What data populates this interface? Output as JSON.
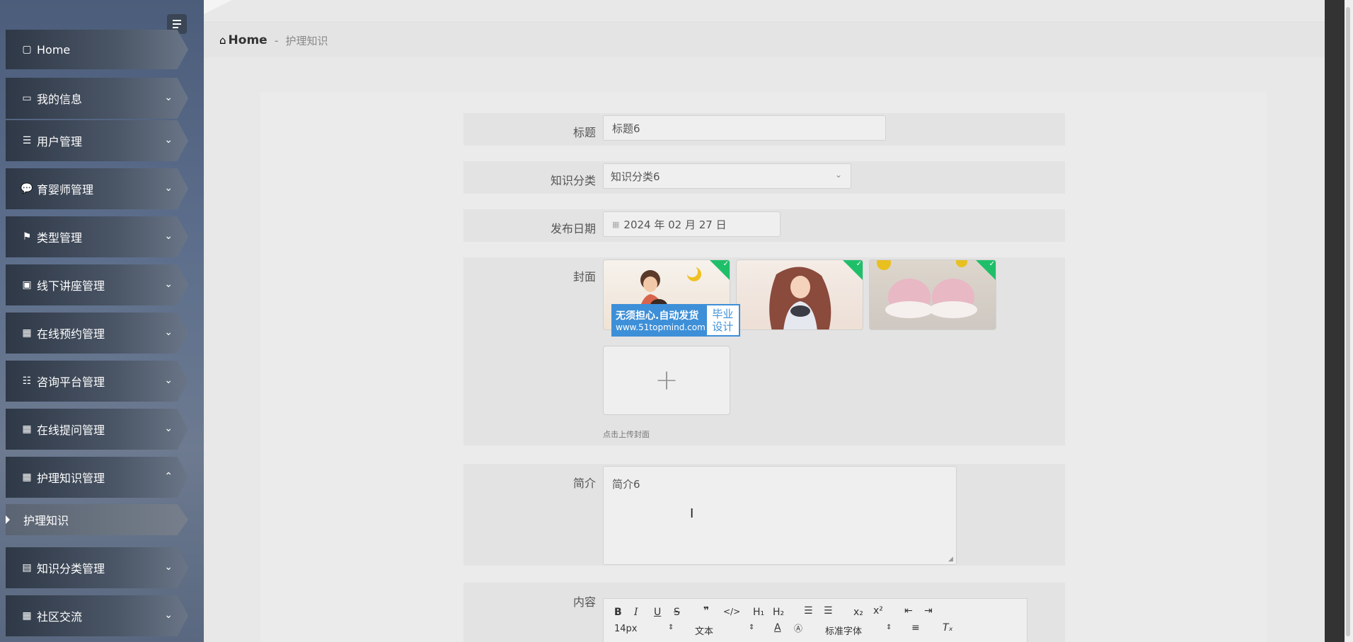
{
  "sidebar": {
    "items": [
      {
        "label": "Home",
        "icon": "home-icon"
      },
      {
        "label": "我的信息",
        "icon": "card-icon"
      },
      {
        "label": "用户管理",
        "icon": "list-icon"
      },
      {
        "label": "育婴师管理",
        "icon": "chat-icon"
      },
      {
        "label": "类型管理",
        "icon": "flag-icon"
      },
      {
        "label": "线下讲座管理",
        "icon": "briefcase-icon"
      },
      {
        "label": "在线预约管理",
        "icon": "grid-icon"
      },
      {
        "label": "咨询平台管理",
        "icon": "sliders-icon"
      },
      {
        "label": "在线提问管理",
        "icon": "grid-icon"
      },
      {
        "label": "护理知识管理",
        "icon": "grid-icon"
      },
      {
        "label": "知识分类管理",
        "icon": "wallet-icon"
      },
      {
        "label": "社区交流",
        "icon": "grid-icon"
      }
    ],
    "sub_item": "护理知识"
  },
  "breadcrumb": {
    "home": "Home",
    "separator": "-",
    "current": "护理知识"
  },
  "form": {
    "title_label": "标题",
    "title_value": "标题6",
    "category_label": "知识分类",
    "category_value": "知识分类6",
    "date_label": "发布日期",
    "date_value": "2024 年 02 月 27 日",
    "cover_label": "封面",
    "cover_hint": "点击上传封面",
    "intro_label": "简介",
    "intro_value": "简介6",
    "content_label": "内容"
  },
  "watermark": {
    "line1": "无须担心.自动发货",
    "line2": "www.51topmind.com",
    "right_top": "毕业",
    "right_bottom": "设计"
  },
  "editor": {
    "font_size": "14px",
    "text_type": "文本",
    "font_family": "标准字体"
  },
  "colors": {
    "badge": "#1fbf6a",
    "watermark": "#3d8fd8"
  }
}
